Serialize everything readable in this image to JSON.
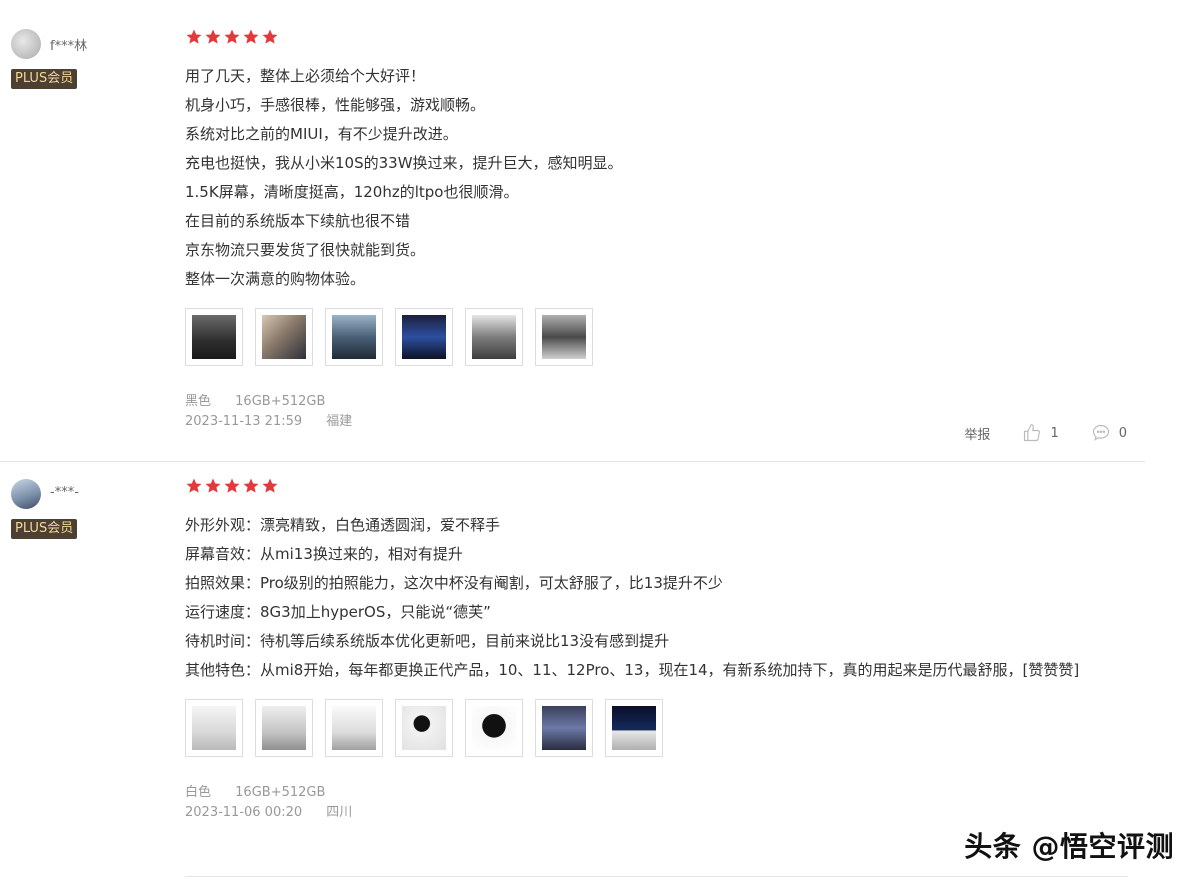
{
  "reviews": [
    {
      "username": "f***林",
      "badge": "PLUS会员",
      "rating": 5,
      "lines": [
        "用了几天，整体上必须给个大好评！",
        "机身小巧，手感很棒，性能够强，游戏顺畅。",
        "系统对比之前的MIUI，有不少提升改进。",
        "充电也挺快，我从小米10S的33W换过来，提升巨大，感知明显。",
        "1.5K屏幕，清晰度挺高，120hz的ltpo也很顺滑。",
        "在目前的系统版本下续航也很不错",
        "京东物流只要发货了很快就能到货。",
        "整体一次满意的购物体验。"
      ],
      "photo_count": 6,
      "color": "黑色",
      "spec": "16GB+512GB",
      "date": "2023-11-13 21:59",
      "location": "福建",
      "report_label": "举报",
      "likes": "1",
      "comments": "0"
    },
    {
      "username": "-***-",
      "badge": "PLUS会员",
      "rating": 5,
      "lines": [
        "外形外观：漂亮精致，白色通透圆润，爱不释手",
        "屏幕音效：从mi13换过来的，相对有提升",
        "拍照效果：Pro级别的拍照能力，这次中杯没有阉割，可太舒服了，比13提升不少",
        "运行速度：8G3加上hyperOS，只能说“德芙”",
        "待机时间：待机等后续系统版本优化更新吧，目前来说比13没有感到提升",
        "其他特色：从mi8开始，每年都更换正代产品，10、11、12Pro、13，现在14，有新系统加持下，真的用起来是历代最舒服，[赞赞赞]"
      ],
      "photo_count": 7,
      "color": "白色",
      "spec": "16GB+512GB",
      "date": "2023-11-06 00:20",
      "location": "四川"
    }
  ],
  "watermark": "头条 @悟空评测",
  "colors": {
    "star": "#e4393c",
    "badge_bg": "#4b4031",
    "badge_text": "#f4d796"
  },
  "icons": {
    "star": "star-icon",
    "like": "thumbs-up-icon",
    "comment": "comment-bubble-icon"
  }
}
